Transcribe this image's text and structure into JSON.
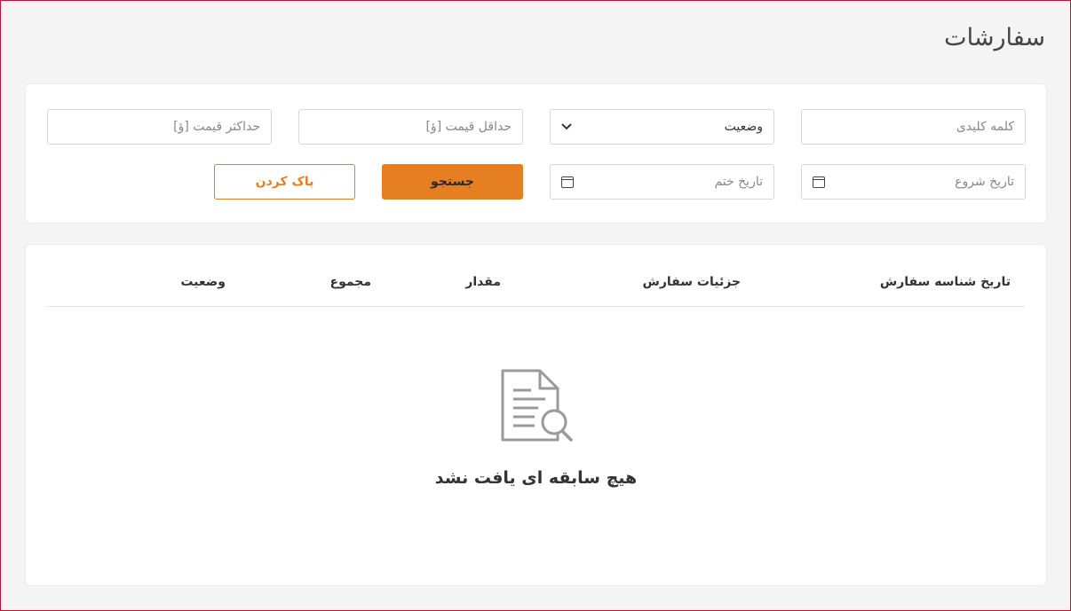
{
  "page": {
    "title": "سفارشات"
  },
  "filters": {
    "keyword_placeholder": "کلمه کلیدی",
    "status_value": "وضعیت",
    "min_price_placeholder": "حداقل قیمت [ؤ]",
    "max_price_placeholder": "حداکثر قیمت [ؤ]",
    "start_date_placeholder": "تاریخ شروع",
    "end_date_placeholder": "تاریخ ختم",
    "search_label": "جستجو",
    "clear_label": "پاک کردن"
  },
  "table": {
    "columns": [
      "تاریخ شناسه سفارش",
      "جزئیات سفارش",
      "مقدار",
      "مجموع",
      "وضعیت"
    ],
    "rows": [],
    "empty_message": "هیچ سابقه ای یافت نشد"
  },
  "colors": {
    "accent": "#e67e22",
    "background": "#f4f4f5"
  },
  "icons": {
    "empty_state": "document-search-icon",
    "calendar": "calendar-icon",
    "dropdown": "chevron-down-icon"
  }
}
